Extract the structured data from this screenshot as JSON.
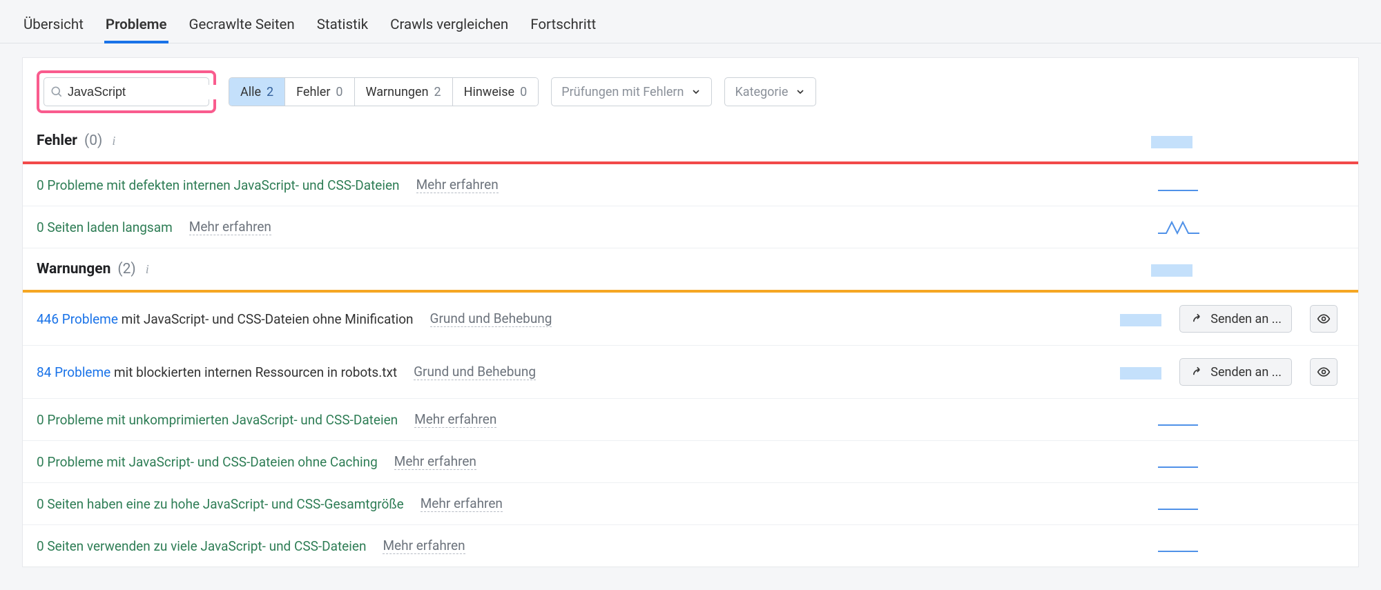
{
  "tabs": {
    "overview": "Übersicht",
    "issues": "Probleme",
    "crawled": "Gecrawlte Seiten",
    "statistics": "Statistik",
    "compare": "Crawls vergleichen",
    "progress": "Fortschritt",
    "active": "issues"
  },
  "search": {
    "value": "JavaScript"
  },
  "segments": {
    "all": {
      "label": "Alle",
      "count": "2"
    },
    "errors": {
      "label": "Fehler",
      "count": "0"
    },
    "warnings": {
      "label": "Warnungen",
      "count": "2"
    },
    "notices": {
      "label": "Hinweise",
      "count": "0"
    }
  },
  "dropdowns": {
    "checks": "Prüfungen mit Fehlern",
    "category": "Kategorie"
  },
  "sections": {
    "errors": {
      "title": "Fehler",
      "count": "(0)"
    },
    "warnings": {
      "title": "Warnungen",
      "count": "(2)"
    }
  },
  "learn_more": "Mehr erfahren",
  "reason_fix": "Grund und Behebung",
  "send_button": "Senden an ...",
  "rows": {
    "err1": "0 Probleme mit defekten internen JavaScript- und CSS-Dateien",
    "err2": "0 Seiten laden langsam",
    "w1_num": "446 Probleme",
    "w1_rest": " mit JavaScript- und CSS-Dateien ohne Minification",
    "w2_num": "84 Probleme",
    "w2_rest": " mit blockierten internen Ressourcen in robots.txt",
    "w3": "0 Probleme mit unkomprimierten JavaScript- und CSS-Dateien",
    "w4": "0 Probleme mit JavaScript- und CSS-Dateien ohne Caching",
    "w5": "0 Seiten haben eine zu hohe JavaScript- und CSS-Gesamtgröße",
    "w6": "0 Seiten verwenden zu viele JavaScript- und CSS-Dateien"
  }
}
